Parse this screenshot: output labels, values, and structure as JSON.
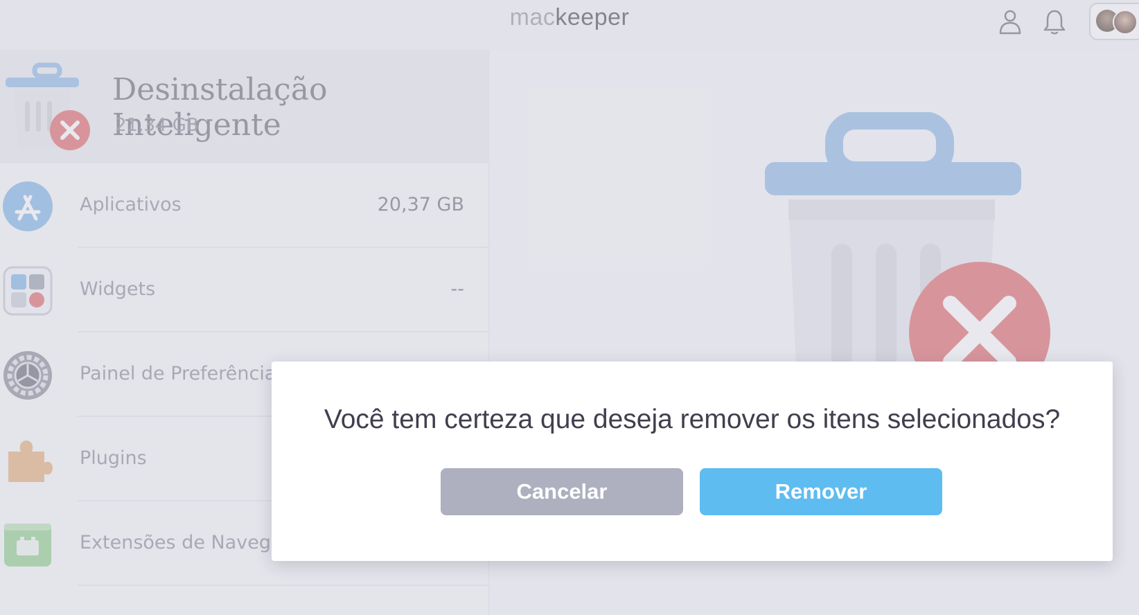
{
  "header": {
    "brand_prefix": "mac",
    "brand_suffix": "keeper",
    "icons": [
      "user-icon",
      "bell-icon",
      "avatars"
    ]
  },
  "sidebar": {
    "title": "Desinstalação Inteligente",
    "total_size": "21,34 GB",
    "items": [
      {
        "label": "Aplicativos",
        "value": "20,37 GB",
        "icon": "app-store-icon"
      },
      {
        "label": "Widgets",
        "value": "--",
        "icon": "widgets-icon"
      },
      {
        "label": "Painel de Preferências",
        "value": "",
        "icon": "preferences-gear-icon"
      },
      {
        "label": "Plugins",
        "value": "",
        "icon": "puzzle-piece-icon"
      },
      {
        "label": "Extensões de Navegador",
        "value": "",
        "icon": "browser-extension-icon"
      }
    ]
  },
  "dialog": {
    "message": "Você tem certeza que deseja remover os itens selecionados?",
    "cancel_label": "Cancelar",
    "remove_label": "Remover"
  },
  "colors": {
    "accent_blue": "#5ebcf1",
    "cancel_gray": "#aeb0bf",
    "trash_blue": "#8fbbe6",
    "remove_red": "#e06969"
  }
}
